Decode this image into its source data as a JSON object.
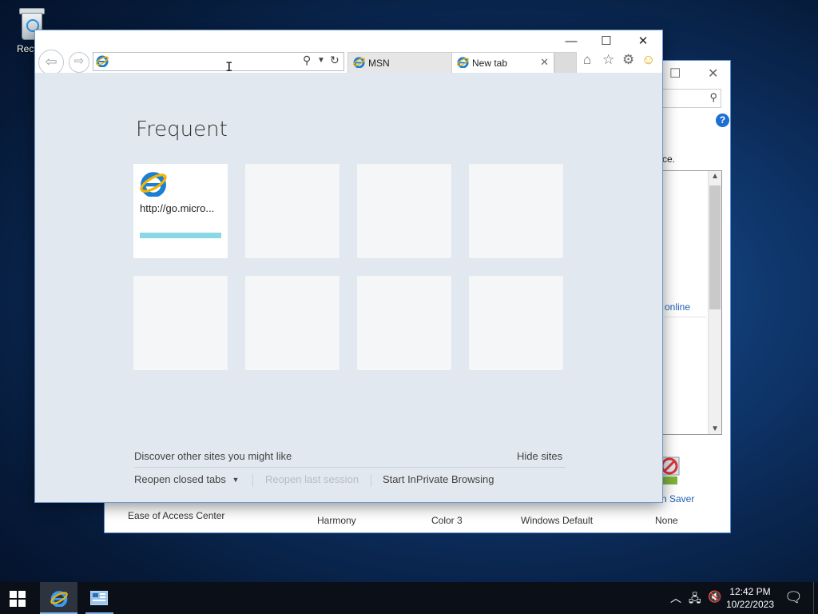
{
  "desktop": {
    "recycle_bin_label": "Recycl"
  },
  "control_panel": {
    "description_fragment": "ce.",
    "online_link": "online",
    "screensaver_label": "n Saver",
    "help_label": "?",
    "bottom_labels": [
      "Ease of Access Center",
      "Harmony",
      "Color 3",
      "Windows Default",
      "None"
    ]
  },
  "ie": {
    "address": {
      "value": "",
      "placeholder": ""
    },
    "tabs": [
      {
        "label": "MSN"
      },
      {
        "label": "New tab"
      }
    ],
    "new_tab_page": {
      "heading": "Frequent",
      "tiles": [
        {
          "url": "http://go.micro..."
        }
      ],
      "discover_label": "Discover other sites you might like",
      "hide_sites_label": "Hide sites",
      "reopen_closed_tabs_label": "Reopen closed tabs",
      "reopen_last_session_label": "Reopen last session",
      "inprivate_label": "Start InPrivate Browsing"
    }
  },
  "taskbar": {
    "time": "12:42 PM",
    "date": "10/22/2023"
  },
  "colors": {
    "accent": "#1f5fb0",
    "tile_bar": "#8ad7e6",
    "ie_background": "#e1e8ef"
  }
}
